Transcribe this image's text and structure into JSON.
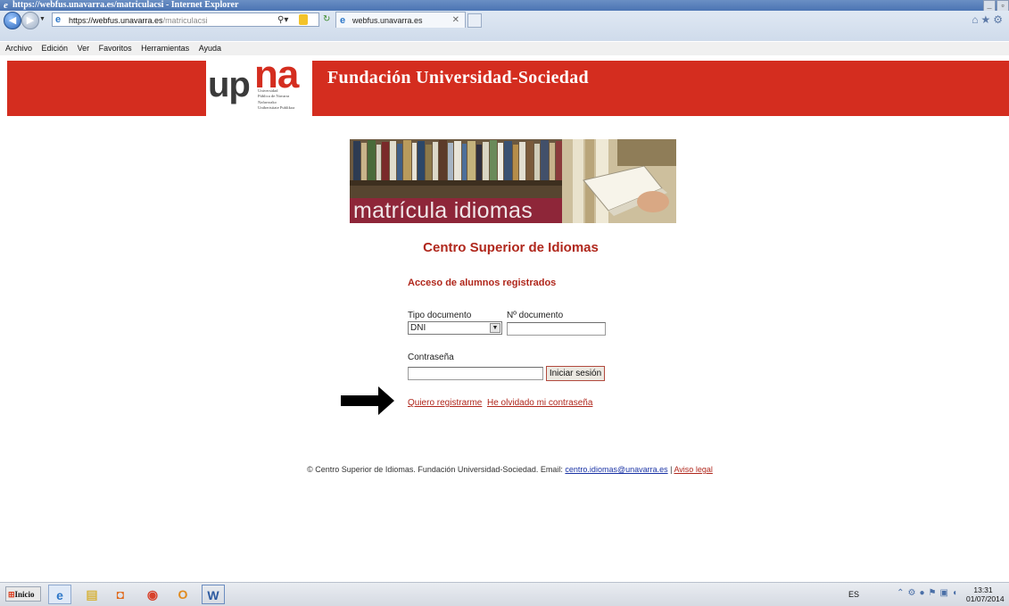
{
  "browser": {
    "window_title": "https://webfus.unavarra.es/matriculacsi - Internet Explorer",
    "address": {
      "host": "https://webfus.unavarra.es",
      "path": "/matriculacsi"
    },
    "tab_label": "webfus.unavarra.es",
    "menu": [
      "Archivo",
      "Edición",
      "Ver",
      "Favoritos",
      "Herramientas",
      "Ayuda"
    ]
  },
  "header": {
    "logo_up": "up",
    "logo_na": "na",
    "logo_lines": [
      "Universidad",
      "Pública de Navarra",
      "Nafarroako",
      "Unibertsitate Publikoa"
    ],
    "title": "Fundación Universidad-Sociedad"
  },
  "banner": {
    "caption": "matrícula idiomas"
  },
  "main": {
    "section_title": "Centro Superior de Idiomas",
    "access_title": "Acceso de alumnos registrados",
    "doc_type_label": "Tipo documento",
    "doc_type_value": "DNI",
    "doc_number_label": "Nº documento",
    "doc_number_value": "",
    "password_label": "Contraseña",
    "password_value": "",
    "login_button": "Iniciar sesión",
    "register_link": "Quiero registrarme",
    "forgot_link": "He olvidado mi contraseña"
  },
  "footer": {
    "text": "© Centro Superior de Idiomas. Fundación Universidad-Sociedad. Email: ",
    "email": "centro.idiomas@unavarra.es",
    "separator": " | ",
    "legal": "Aviso legal"
  },
  "taskbar": {
    "start_label": "Inicio",
    "language": "ES",
    "time": "13:31",
    "date": "01/07/2014"
  },
  "colors": {
    "brand_red": "#d42d1f",
    "link_red": "#b0271c",
    "banner_caption": "#8e2639"
  }
}
